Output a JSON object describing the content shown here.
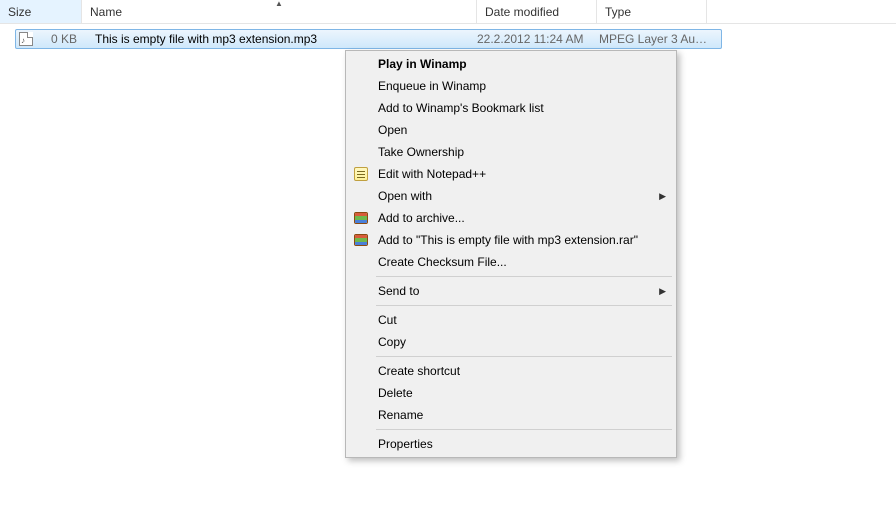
{
  "columns": {
    "size": "Size",
    "name": "Name",
    "date": "Date modified",
    "type": "Type"
  },
  "file": {
    "size": "0 KB",
    "name": "This is empty file with mp3 extension.mp3",
    "date": "22.2.2012 11:24 AM",
    "type": "MPEG Layer 3 Aud..."
  },
  "menu": {
    "play": "Play in Winamp",
    "enqueue": "Enqueue in Winamp",
    "bookmark": "Add to Winamp's Bookmark list",
    "open": "Open",
    "takeown": "Take Ownership",
    "editnpp": "Edit with Notepad++",
    "openwith": "Open with",
    "addarchive": "Add to archive...",
    "addrar": "Add to \"This is empty file with mp3 extension.rar\"",
    "checksum": "Create Checksum File...",
    "sendto": "Send to",
    "cut": "Cut",
    "copy": "Copy",
    "shortcut": "Create shortcut",
    "delete": "Delete",
    "rename": "Rename",
    "properties": "Properties"
  }
}
